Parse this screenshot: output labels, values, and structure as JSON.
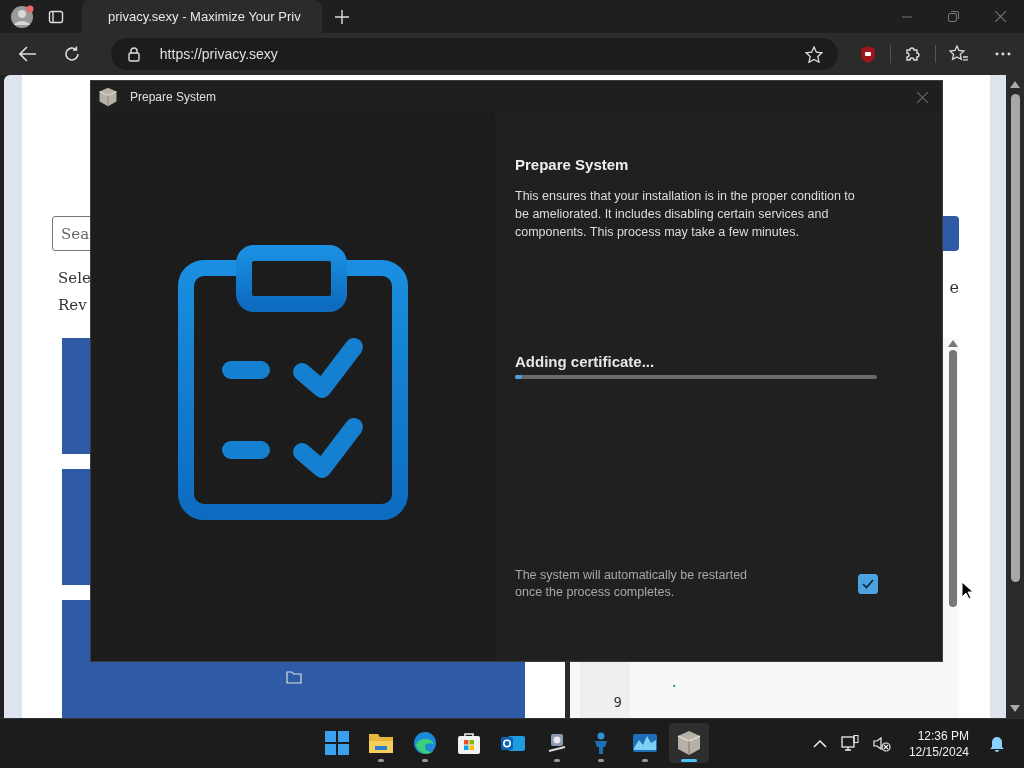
{
  "browser": {
    "tab_title": "privacy.sexy - Maximize Your Priv",
    "url": "https://privacy.sexy"
  },
  "page": {
    "search": {
      "placeholder": "Sea"
    },
    "intro_lines": [
      "Sele",
      "Rev"
    ],
    "side_text": "e",
    "code_lines": [
      {
        "text": "."
      },
      {
        "number": "9"
      }
    ]
  },
  "dialog": {
    "title": "Prepare System",
    "heading": "Prepare System",
    "description": "This ensures that your installation is in the proper condition to be ameliorated. It includes disabling certain services and components. This process may take a few minutes.",
    "status": "Adding certificate...",
    "level": 0.02,
    "note": "The system will automatically be restarted once the process completes.",
    "restart_checked": true
  },
  "taskbar": {
    "apps": [
      {
        "kind": "start",
        "running": false,
        "selected": false
      },
      {
        "kind": "explorer",
        "running": true,
        "selected": false
      },
      {
        "kind": "edge",
        "running": true,
        "selected": false
      },
      {
        "kind": "store",
        "running": false,
        "selected": false
      },
      {
        "kind": "outlook",
        "running": false,
        "selected": false
      },
      {
        "kind": "tool",
        "running": true,
        "selected": false
      },
      {
        "kind": "figure",
        "running": true,
        "selected": false
      },
      {
        "kind": "monitor",
        "running": true,
        "selected": false
      },
      {
        "kind": "box",
        "running": true,
        "selected": true
      }
    ],
    "time": "12:36 PM",
    "date": "12/15/2024"
  }
}
